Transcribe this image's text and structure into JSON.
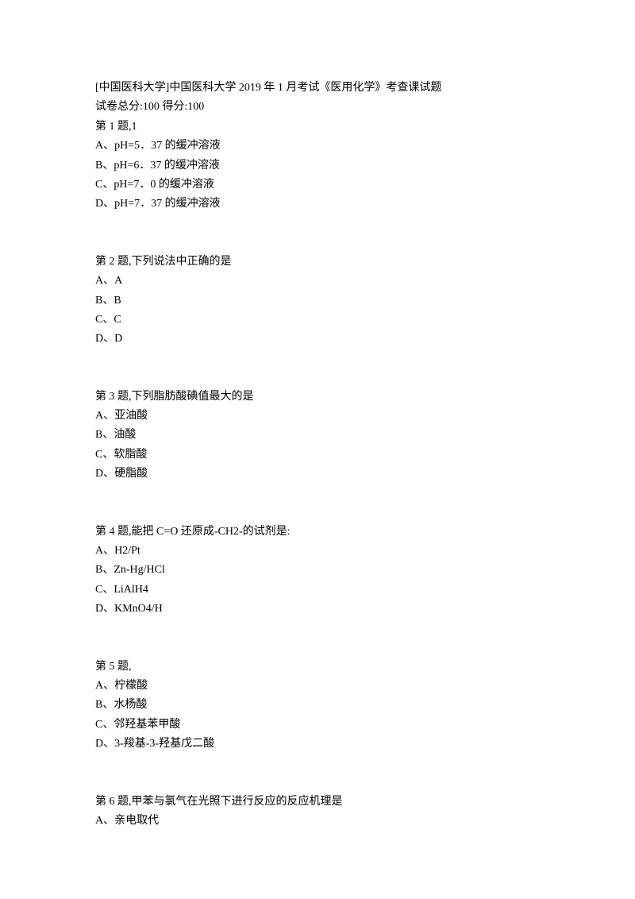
{
  "header": {
    "title": "[中国医科大学]中国医科大学 2019 年 1 月考试《医用化学》考查课试题",
    "score_label": "试卷总分:100    得分:100"
  },
  "questions": [
    {
      "header": "第 1 题,1",
      "options": [
        "A、pH=5．37 的缓冲溶液",
        "B、pH=6．37 的缓冲溶液",
        "C、pH=7．0 的缓冲溶液",
        "D、pH=7．37 的缓冲溶液"
      ]
    },
    {
      "header": "第 2 题,下列说法中正确的是",
      "options": [
        "A、A",
        "B、B",
        "C、C",
        "D、D"
      ]
    },
    {
      "header": "第 3 题,下列脂肪酸碘值最大的是",
      "options": [
        "A、亚油酸",
        "B、油酸",
        "C、软脂酸",
        "D、硬脂酸"
      ]
    },
    {
      "header": "第 4 题,能把 C=O 还原成-CH2-的试剂是:",
      "options": [
        "A、H2/Pt",
        "B、Zn-Hg/HCl",
        "C、LiAlH4",
        "D、KMnO4/H"
      ]
    },
    {
      "header": "第 5 题,",
      "options": [
        "A、柠檬酸",
        "B、水杨酸",
        "C、邻羟基苯甲酸",
        "D、3-羧基-3-羟基戊二酸"
      ]
    },
    {
      "header": "第 6 题,甲苯与氯气在光照下进行反应的反应机理是",
      "options": [
        "A、亲电取代"
      ]
    }
  ]
}
